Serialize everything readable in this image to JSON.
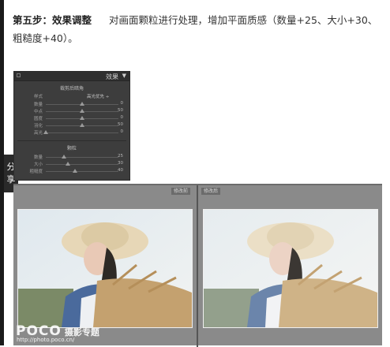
{
  "instruction": {
    "step_title": "第五步：效果调整",
    "body": "对画面颗粒进行处理，增加平面质感（数量+25、大小+30、粗糙度+40）。"
  },
  "share_tab": "分享",
  "effects_panel": {
    "title": "效果",
    "vignette_section": {
      "title": "裁剪后暗角",
      "style_label": "样式",
      "style_value": "高光优先 ÷",
      "sliders": [
        {
          "label": "数量",
          "value": "0",
          "level": 0.5
        },
        {
          "label": "中点",
          "value": "50",
          "level": 0.5
        },
        {
          "label": "圆度",
          "value": "0",
          "level": 0.5
        },
        {
          "label": "羽化",
          "value": "50",
          "level": 0.5
        },
        {
          "label": "高光",
          "value": "0",
          "level": 0.0
        }
      ]
    },
    "grain_section": {
      "title": "颗粒",
      "sliders": [
        {
          "label": "数量",
          "value": "25",
          "level": 0.25
        },
        {
          "label": "大小",
          "value": "30",
          "level": 0.3
        },
        {
          "label": "粗糙度",
          "value": "40",
          "level": 0.4
        }
      ]
    }
  },
  "comparison": {
    "before_label": "修改前",
    "after_label": "修改后"
  },
  "watermark": {
    "logo": "POCO",
    "cn": "摄影专题",
    "url": "http://photo.poco.cn/"
  }
}
